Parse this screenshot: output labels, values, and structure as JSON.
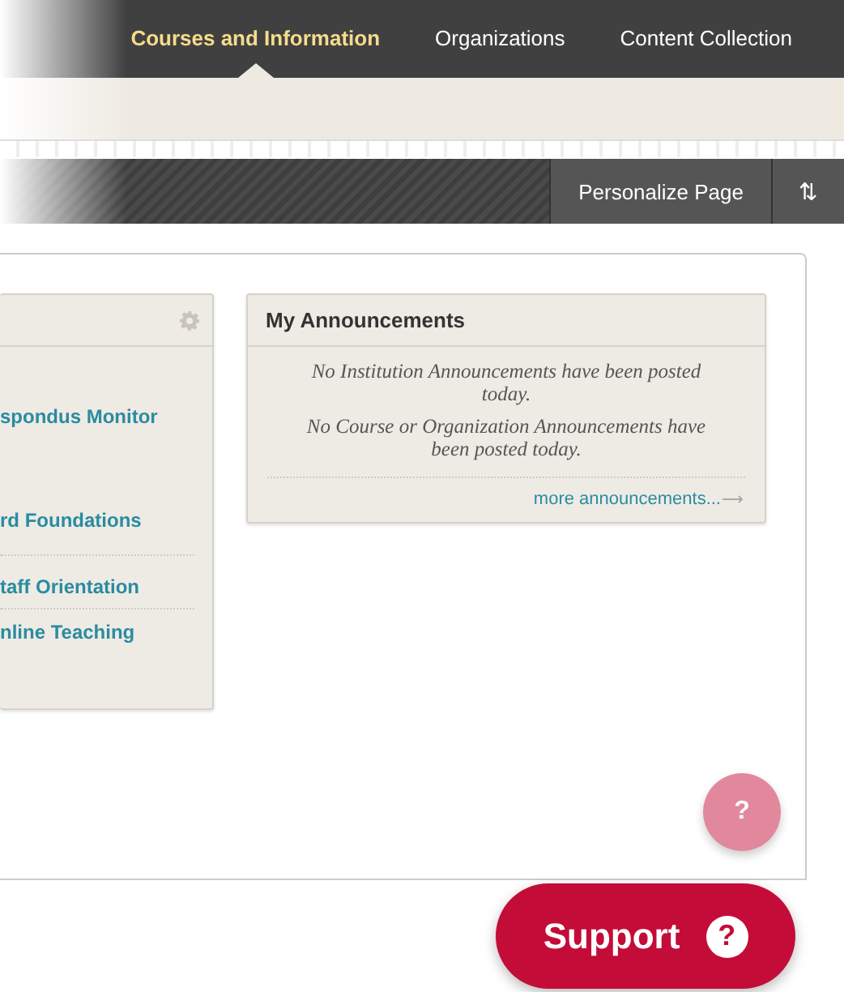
{
  "nav_tabs": [
    {
      "label": "Courses and Information",
      "selected": true
    },
    {
      "label": "Organizations",
      "selected": false
    },
    {
      "label": "Content Collection",
      "selected": false
    }
  ],
  "toolbar": {
    "personalize_button": "Personalize Page",
    "reorder_button": "⇅"
  },
  "left_module": {
    "links": [
      "spondus Monitor",
      "rd Foundations",
      "taff Orientation",
      "nline Teaching"
    ]
  },
  "announcements": {
    "title": "My Announcements",
    "messages": [
      "No Institution Announcements have been posted today.",
      "No Course or Organization Announcements have been posted today."
    ],
    "more_link": "more announcements..."
  },
  "help_button": "?",
  "support_button": {
    "label": "Support",
    "icon": "?"
  }
}
